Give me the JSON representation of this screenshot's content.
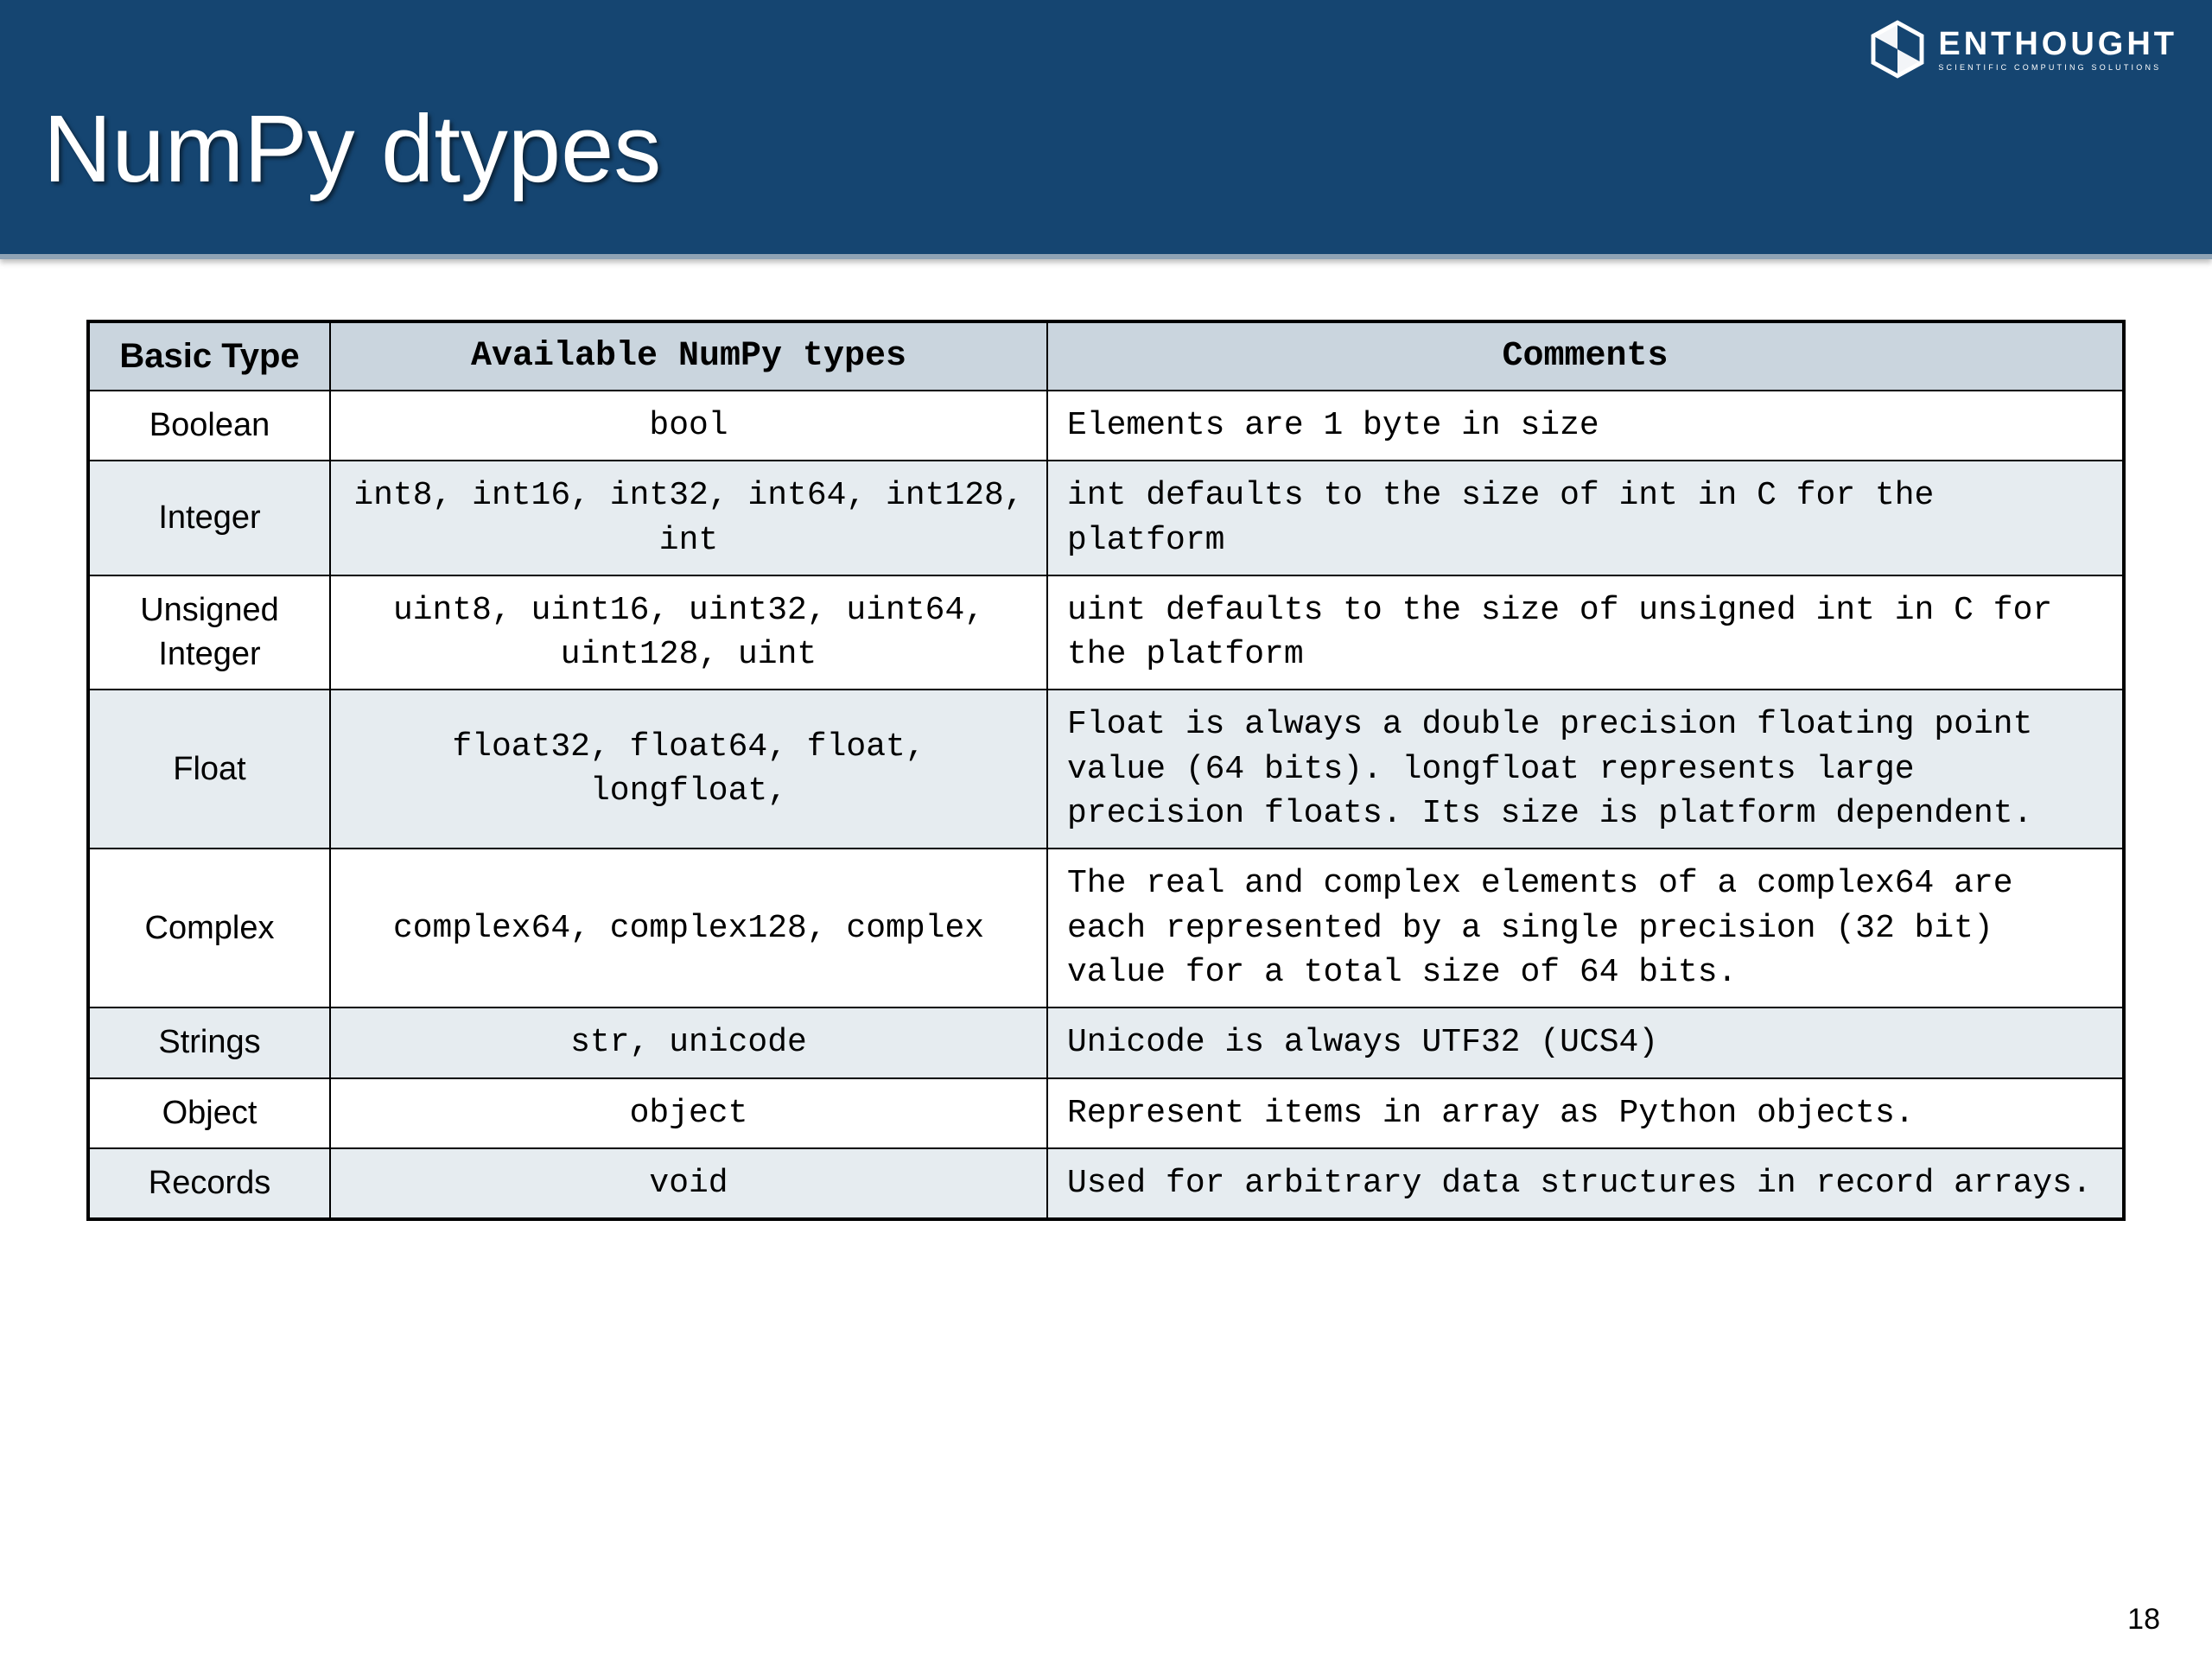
{
  "header": {
    "title": "NumPy dtypes",
    "brand": "ENTHOUGHT",
    "brand_sub": "SCIENTIFIC COMPUTING SOLUTIONS"
  },
  "table": {
    "headers": {
      "basic": "Basic Type",
      "types": "Available NumPy types",
      "comments": "Comments"
    },
    "rows": [
      {
        "basic": "Boolean",
        "types": "bool",
        "comments": "Elements are 1 byte in size",
        "shade": false
      },
      {
        "basic": "Integer",
        "types": "int8, int16, int32, int64, int128, int",
        "comments": "int defaults to the size of int in C for the platform",
        "shade": true
      },
      {
        "basic": "Unsigned Integer",
        "types": "uint8, uint16, uint32, uint64, uint128, uint",
        "comments": "uint defaults to the size of unsigned int in C for the platform",
        "shade": false
      },
      {
        "basic": "Float",
        "types": "float32, float64, float, longfloat,",
        "comments": "Float is always a double precision floating point value (64 bits). longfloat represents large precision floats.  Its size is platform dependent.",
        "shade": true
      },
      {
        "basic": "Complex",
        "types": "complex64, complex128, complex",
        "comments": "The real and complex elements of a complex64 are each represented by a single precision (32 bit) value for a total size of 64 bits.",
        "shade": false
      },
      {
        "basic": "Strings",
        "types": "str, unicode",
        "comments": "Unicode is always UTF32 (UCS4)",
        "shade": true
      },
      {
        "basic": "Object",
        "types": "object",
        "comments": "Represent items in array as Python objects.",
        "shade": false
      },
      {
        "basic": "Records",
        "types": "void",
        "comments": "Used for arbitrary data structures in record arrays.",
        "shade": true
      }
    ]
  },
  "page_number": "18"
}
